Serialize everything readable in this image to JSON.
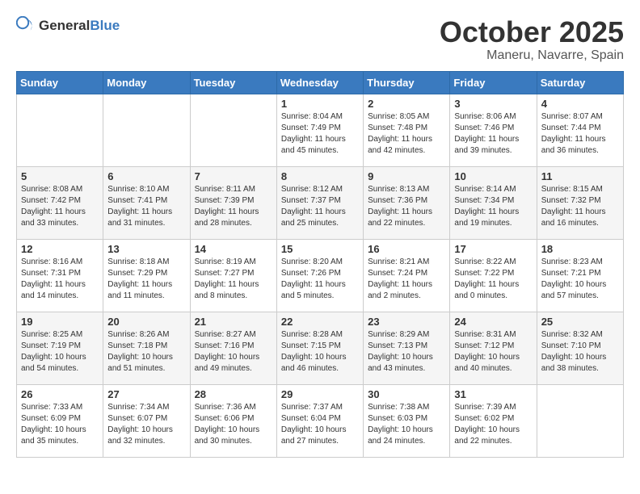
{
  "logo": {
    "general": "General",
    "blue": "Blue"
  },
  "title": "October 2025",
  "subtitle": "Maneru, Navarre, Spain",
  "days_of_week": [
    "Sunday",
    "Monday",
    "Tuesday",
    "Wednesday",
    "Thursday",
    "Friday",
    "Saturday"
  ],
  "weeks": [
    [
      {
        "day": "",
        "info": ""
      },
      {
        "day": "",
        "info": ""
      },
      {
        "day": "",
        "info": ""
      },
      {
        "day": "1",
        "info": "Sunrise: 8:04 AM\nSunset: 7:49 PM\nDaylight: 11 hours and 45 minutes."
      },
      {
        "day": "2",
        "info": "Sunrise: 8:05 AM\nSunset: 7:48 PM\nDaylight: 11 hours and 42 minutes."
      },
      {
        "day": "3",
        "info": "Sunrise: 8:06 AM\nSunset: 7:46 PM\nDaylight: 11 hours and 39 minutes."
      },
      {
        "day": "4",
        "info": "Sunrise: 8:07 AM\nSunset: 7:44 PM\nDaylight: 11 hours and 36 minutes."
      }
    ],
    [
      {
        "day": "5",
        "info": "Sunrise: 8:08 AM\nSunset: 7:42 PM\nDaylight: 11 hours and 33 minutes."
      },
      {
        "day": "6",
        "info": "Sunrise: 8:10 AM\nSunset: 7:41 PM\nDaylight: 11 hours and 31 minutes."
      },
      {
        "day": "7",
        "info": "Sunrise: 8:11 AM\nSunset: 7:39 PM\nDaylight: 11 hours and 28 minutes."
      },
      {
        "day": "8",
        "info": "Sunrise: 8:12 AM\nSunset: 7:37 PM\nDaylight: 11 hours and 25 minutes."
      },
      {
        "day": "9",
        "info": "Sunrise: 8:13 AM\nSunset: 7:36 PM\nDaylight: 11 hours and 22 minutes."
      },
      {
        "day": "10",
        "info": "Sunrise: 8:14 AM\nSunset: 7:34 PM\nDaylight: 11 hours and 19 minutes."
      },
      {
        "day": "11",
        "info": "Sunrise: 8:15 AM\nSunset: 7:32 PM\nDaylight: 11 hours and 16 minutes."
      }
    ],
    [
      {
        "day": "12",
        "info": "Sunrise: 8:16 AM\nSunset: 7:31 PM\nDaylight: 11 hours and 14 minutes."
      },
      {
        "day": "13",
        "info": "Sunrise: 8:18 AM\nSunset: 7:29 PM\nDaylight: 11 hours and 11 minutes."
      },
      {
        "day": "14",
        "info": "Sunrise: 8:19 AM\nSunset: 7:27 PM\nDaylight: 11 hours and 8 minutes."
      },
      {
        "day": "15",
        "info": "Sunrise: 8:20 AM\nSunset: 7:26 PM\nDaylight: 11 hours and 5 minutes."
      },
      {
        "day": "16",
        "info": "Sunrise: 8:21 AM\nSunset: 7:24 PM\nDaylight: 11 hours and 2 minutes."
      },
      {
        "day": "17",
        "info": "Sunrise: 8:22 AM\nSunset: 7:22 PM\nDaylight: 11 hours and 0 minutes."
      },
      {
        "day": "18",
        "info": "Sunrise: 8:23 AM\nSunset: 7:21 PM\nDaylight: 10 hours and 57 minutes."
      }
    ],
    [
      {
        "day": "19",
        "info": "Sunrise: 8:25 AM\nSunset: 7:19 PM\nDaylight: 10 hours and 54 minutes."
      },
      {
        "day": "20",
        "info": "Sunrise: 8:26 AM\nSunset: 7:18 PM\nDaylight: 10 hours and 51 minutes."
      },
      {
        "day": "21",
        "info": "Sunrise: 8:27 AM\nSunset: 7:16 PM\nDaylight: 10 hours and 49 minutes."
      },
      {
        "day": "22",
        "info": "Sunrise: 8:28 AM\nSunset: 7:15 PM\nDaylight: 10 hours and 46 minutes."
      },
      {
        "day": "23",
        "info": "Sunrise: 8:29 AM\nSunset: 7:13 PM\nDaylight: 10 hours and 43 minutes."
      },
      {
        "day": "24",
        "info": "Sunrise: 8:31 AM\nSunset: 7:12 PM\nDaylight: 10 hours and 40 minutes."
      },
      {
        "day": "25",
        "info": "Sunrise: 8:32 AM\nSunset: 7:10 PM\nDaylight: 10 hours and 38 minutes."
      }
    ],
    [
      {
        "day": "26",
        "info": "Sunrise: 7:33 AM\nSunset: 6:09 PM\nDaylight: 10 hours and 35 minutes."
      },
      {
        "day": "27",
        "info": "Sunrise: 7:34 AM\nSunset: 6:07 PM\nDaylight: 10 hours and 32 minutes."
      },
      {
        "day": "28",
        "info": "Sunrise: 7:36 AM\nSunset: 6:06 PM\nDaylight: 10 hours and 30 minutes."
      },
      {
        "day": "29",
        "info": "Sunrise: 7:37 AM\nSunset: 6:04 PM\nDaylight: 10 hours and 27 minutes."
      },
      {
        "day": "30",
        "info": "Sunrise: 7:38 AM\nSunset: 6:03 PM\nDaylight: 10 hours and 24 minutes."
      },
      {
        "day": "31",
        "info": "Sunrise: 7:39 AM\nSunset: 6:02 PM\nDaylight: 10 hours and 22 minutes."
      },
      {
        "day": "",
        "info": ""
      }
    ]
  ]
}
